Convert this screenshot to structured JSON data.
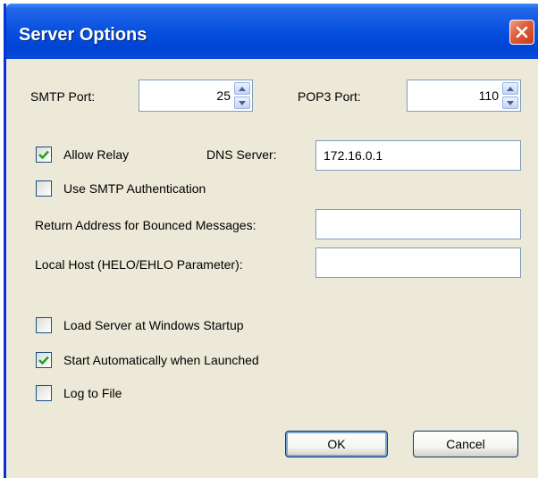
{
  "window": {
    "title": "Server Options"
  },
  "smtp_port": {
    "label": "SMTP Port:",
    "value": "25"
  },
  "pop3_port": {
    "label": "POP3 Port:",
    "value": "110"
  },
  "allow_relay": {
    "label": "Allow Relay",
    "checked": true
  },
  "dns_server": {
    "label": "DNS Server:",
    "value": "172.16.0.1"
  },
  "use_smtp_auth": {
    "label": "Use SMTP Authentication",
    "checked": false
  },
  "return_address": {
    "label": "Return Address for Bounced Messages:",
    "value": ""
  },
  "local_host": {
    "label": "Local Host (HELO/EHLO Parameter):",
    "value": ""
  },
  "load_at_startup": {
    "label": "Load Server at Windows Startup",
    "checked": false
  },
  "start_automatically": {
    "label": "Start Automatically when Launched",
    "checked": true
  },
  "log_to_file": {
    "label": "Log to File",
    "checked": false
  },
  "buttons": {
    "ok": "OK",
    "cancel": "Cancel"
  },
  "icons": {
    "close": "close-icon",
    "check": "checkmark-icon",
    "spin_up": "arrow-up-icon",
    "spin_down": "arrow-down-icon"
  },
  "colors": {
    "titlebar": "#0a52e0",
    "dialog_bg": "#ece9d8",
    "close_button": "#e0603e",
    "checkmark": "#21a121"
  }
}
